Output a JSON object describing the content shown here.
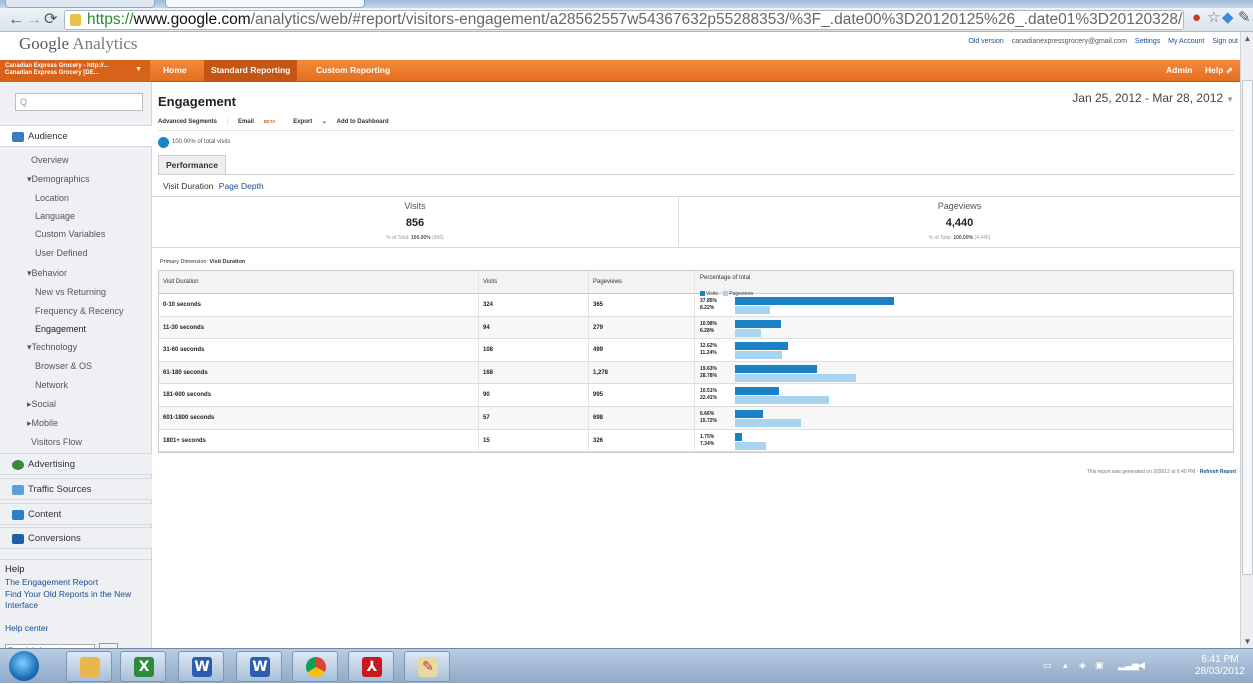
{
  "browser": {
    "url_scheme": "https://",
    "url_host": "www.google.com",
    "url_path": "/analytics/web/#report/visitors-engagement/a28562557w54367632p55288353/%3F_.date00%3D20120125%26_.date01%3D20120328/"
  },
  "header": {
    "logo_text": "Google",
    "logo_product": " Analytics",
    "old_version": "Old version",
    "email": "canadianexpressgrocery@gmail.com",
    "settings": "Settings",
    "my_account": "My Account",
    "sign_out": "Sign out"
  },
  "account": {
    "line1": "Canadian Express Grocery - http://...",
    "line2": "Canadian Express Grocery [DE..."
  },
  "topnav": {
    "home": "Home",
    "standard": "Standard Reporting",
    "custom": "Custom Reporting",
    "admin": "Admin",
    "help": "Help"
  },
  "sidebar": {
    "search_placeholder": "Q",
    "audience": "Audience",
    "overview": "Overview",
    "demographics": "Demographics",
    "location": "Location",
    "language": "Language",
    "custom_variables": "Custom Variables",
    "user_defined": "User Defined",
    "behavior": "Behavior",
    "new_vs_returning": "New vs Returning",
    "frequency": "Frequency & Recency",
    "engagement": "Engagement",
    "technology": "Technology",
    "browser_os": "Browser & OS",
    "network": "Network",
    "social": "Social",
    "mobile": "Mobile",
    "visitors_flow": "Visitors Flow",
    "advertising": "Advertising",
    "traffic_sources": "Traffic Sources",
    "content": "Content",
    "conversions": "Conversions"
  },
  "help": {
    "title": "Help",
    "link1": "The Engagement Report",
    "link2": "Find Your Old Reports in the New Interface",
    "center": "Help center",
    "search_placeholder": "Search help center",
    "go": "Go"
  },
  "report": {
    "title": "Engagement",
    "date_range": "Jan 25, 2012 - Mar 28, 2012",
    "actions": {
      "advanced_segments": "Advanced Segments",
      "email": "Email",
      "beta": "BETA",
      "export": "Export",
      "add_dashboard": "Add to Dashboard"
    },
    "segment": "100.00% of total visits",
    "tab": "Performance",
    "subtab_active": "Visit Duration",
    "subtab_link": "Page Depth",
    "scorecard": {
      "visits_label": "Visits",
      "visits_value": "856",
      "visits_sub_prefix": "% of Total: ",
      "visits_sub_pct": "100.00%",
      "visits_sub_total": "(856)",
      "pageviews_label": "Pageviews",
      "pageviews_value": "4,440",
      "pageviews_sub_prefix": "% of Total: ",
      "pageviews_sub_pct": "100.00%",
      "pageviews_sub_total": "(4,440)"
    },
    "primary_dimension_label": "Primary Dimension:",
    "primary_dimension_value": "Visit Duration",
    "columns": {
      "duration": "Visit Duration",
      "visits": "Visits",
      "pageviews": "Pageviews",
      "pct": "Percentage of total",
      "legend_visits": "Visits",
      "legend_pageviews": "Pageviews"
    },
    "rows": [
      {
        "duration": "0-10 seconds",
        "visits": "324",
        "pageviews": "365",
        "visits_pct": "37.85%",
        "pageviews_pct": "8.22%",
        "v": 37.85,
        "p": 8.22
      },
      {
        "duration": "11-30 seconds",
        "visits": "94",
        "pageviews": "279",
        "visits_pct": "10.98%",
        "pageviews_pct": "6.28%",
        "v": 10.98,
        "p": 6.28
      },
      {
        "duration": "31-60 seconds",
        "visits": "108",
        "pageviews": "499",
        "visits_pct": "12.62%",
        "pageviews_pct": "11.24%",
        "v": 12.62,
        "p": 11.24
      },
      {
        "duration": "61-180 seconds",
        "visits": "168",
        "pageviews": "1,278",
        "visits_pct": "19.63%",
        "pageviews_pct": "28.78%",
        "v": 19.63,
        "p": 28.78
      },
      {
        "duration": "181-600 seconds",
        "visits": "90",
        "pageviews": "995",
        "visits_pct": "10.51%",
        "pageviews_pct": "22.41%",
        "v": 10.51,
        "p": 22.41
      },
      {
        "duration": "601-1800 seconds",
        "visits": "57",
        "pageviews": "698",
        "visits_pct": "6.66%",
        "pageviews_pct": "15.72%",
        "v": 6.66,
        "p": 15.72
      },
      {
        "duration": "1801+ seconds",
        "visits": "15",
        "pageviews": "326",
        "visits_pct": "1.75%",
        "pageviews_pct": "7.34%",
        "v": 1.75,
        "p": 7.34
      }
    ],
    "footer_text": "This report was generated on 3/28/12 at 6:40 PM - ",
    "footer_link": "Refresh Report"
  },
  "taskbar": {
    "time": "6:41 PM",
    "date": "28/03/2012"
  },
  "colors": {
    "orange_nav": "#e66e1f",
    "visits_bar": "#1a82c4",
    "pageviews_bar": "#a8d4ef",
    "link": "#1a4f8f"
  }
}
